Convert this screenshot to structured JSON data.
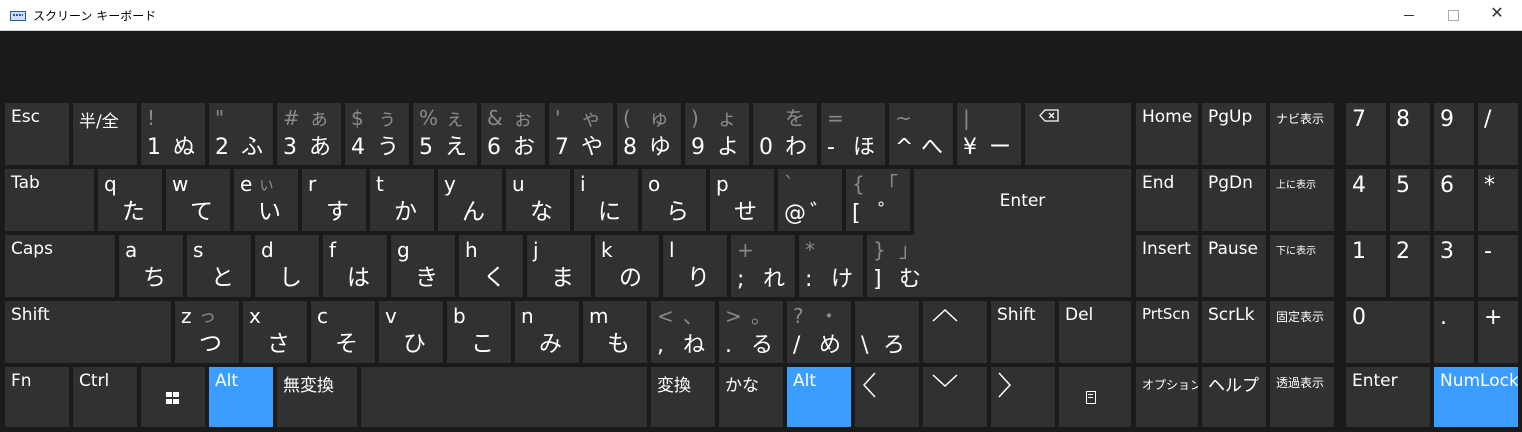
{
  "window": {
    "title": "スクリーン キーボード",
    "minimize": "—",
    "maximize": "□",
    "close": "✕"
  },
  "row1": [
    {
      "name": "esc",
      "label": "Esc"
    },
    {
      "name": "hankaku",
      "label": "半/全"
    },
    {
      "name": "1",
      "s": "!",
      "d": "1",
      "kt": "",
      "kb": "ぬ"
    },
    {
      "name": "2",
      "s": "\"",
      "d": "2",
      "kt": "",
      "kb": "ふ"
    },
    {
      "name": "3",
      "s": "#",
      "d": "3",
      "kt": "ぁ",
      "kb": "あ"
    },
    {
      "name": "4",
      "s": "$",
      "d": "4",
      "kt": "ぅ",
      "kb": "う"
    },
    {
      "name": "5",
      "s": "%",
      "d": "5",
      "kt": "ぇ",
      "kb": "え"
    },
    {
      "name": "6",
      "s": "&",
      "d": "6",
      "kt": "ぉ",
      "kb": "お"
    },
    {
      "name": "7",
      "s": "'",
      "d": "7",
      "kt": "ゃ",
      "kb": "や"
    },
    {
      "name": "8",
      "s": "(",
      "d": "8",
      "kt": "ゅ",
      "kb": "ゆ"
    },
    {
      "name": "9",
      "s": ")",
      "d": "9",
      "kt": "ょ",
      "kb": "よ"
    },
    {
      "name": "0",
      "s": "",
      "d": "0",
      "kt": "を",
      "kb": "わ"
    },
    {
      "name": "minus",
      "s": "=",
      "d": "-",
      "kt": "",
      "kb": "ほ"
    },
    {
      "name": "caret",
      "s": "~",
      "d": "^",
      "kt": "",
      "kb": "へ"
    },
    {
      "name": "yen",
      "s": "|",
      "d": "¥",
      "kt": "",
      "kb": "ー"
    }
  ],
  "row2": [
    {
      "name": "q",
      "l": "q",
      "k": "た"
    },
    {
      "name": "w",
      "l": "w",
      "k": "て"
    },
    {
      "name": "e",
      "l": "e",
      "kt": "ぃ",
      "k": "い"
    },
    {
      "name": "r",
      "l": "r",
      "k": "す"
    },
    {
      "name": "t",
      "l": "t",
      "k": "か"
    },
    {
      "name": "y",
      "l": "y",
      "k": "ん"
    },
    {
      "name": "u",
      "l": "u",
      "k": "な"
    },
    {
      "name": "i",
      "l": "i",
      "k": "に"
    },
    {
      "name": "o",
      "l": "o",
      "k": "ら"
    },
    {
      "name": "p",
      "l": "p",
      "k": "せ"
    }
  ],
  "row2_extra": {
    "at_s": "`",
    "at_d": "@",
    "at_k": "゛",
    "br_s": "{",
    "br_d": "[",
    "br_kt": "「",
    "br_k": "゜"
  },
  "row3": [
    {
      "name": "a",
      "l": "a",
      "k": "ち"
    },
    {
      "name": "s",
      "l": "s",
      "k": "と"
    },
    {
      "name": "d",
      "l": "d",
      "k": "し"
    },
    {
      "name": "f",
      "l": "f",
      "k": "は"
    },
    {
      "name": "g",
      "l": "g",
      "k": "き"
    },
    {
      "name": "h",
      "l": "h",
      "k": "く"
    },
    {
      "name": "j",
      "l": "j",
      "k": "ま"
    },
    {
      "name": "k",
      "l": "k",
      "k": "の"
    },
    {
      "name": "l",
      "l": "l",
      "k": "り"
    }
  ],
  "row3_extra": {
    "semi_s": "+",
    "semi_d": ";",
    "semi_k": "れ",
    "colon_s": "*",
    "colon_d": ":",
    "colon_k": "け",
    "rbr_s": "}",
    "rbr_d": "]",
    "rbr_kt": "」",
    "rbr_k": "む"
  },
  "row4": [
    {
      "name": "z",
      "l": "z",
      "kt": "っ",
      "k": "つ"
    },
    {
      "name": "x",
      "l": "x",
      "k": "さ"
    },
    {
      "name": "c",
      "l": "c",
      "k": "そ"
    },
    {
      "name": "v",
      "l": "v",
      "k": "ひ"
    },
    {
      "name": "b",
      "l": "b",
      "k": "こ"
    },
    {
      "name": "n",
      "l": "n",
      "k": "み"
    },
    {
      "name": "m",
      "l": "m",
      "k": "も"
    }
  ],
  "row4_extra": {
    "comma_s": "<",
    "comma_kt": "、",
    "comma_d": ",",
    "comma_k": "ね",
    "period_s": ">",
    "period_kt": "。",
    "period_d": ".",
    "period_k": "る",
    "slash_s": "?",
    "slash_kt": "・",
    "slash_d": "/",
    "slash_k": "め",
    "bs_d": "\\",
    "bs_k": "ろ"
  },
  "mods": {
    "tab": "Tab",
    "enter": "Enter",
    "caps": "Caps",
    "shift_l": "Shift",
    "shift_r": "Shift",
    "del": "Del",
    "fn": "Fn",
    "ctrl": "Ctrl",
    "alt_l": "Alt",
    "muhenkan": "無変換",
    "henkan": "変換",
    "kana": "かな",
    "alt_r": "Alt",
    "up": "^",
    "down": "v",
    "left": "<",
    "right": ">"
  },
  "nav": {
    "home": "Home",
    "pgup": "PgUp",
    "navi": "ナビ表示",
    "end": "End",
    "pgdn": "PgDn",
    "up_show": "上に表示",
    "insert": "Insert",
    "pause": "Pause",
    "down_show": "下に表示",
    "prtscn": "PrtScn",
    "scrlk": "ScrLk",
    "fix_show": "固定表示",
    "options": "オプション",
    "help": "ヘルプ",
    "trans_show": "透過表示"
  },
  "numpad": {
    "n7": "7",
    "n8": "8",
    "n9": "9",
    "div": "/",
    "n4": "4",
    "n5": "5",
    "n6": "6",
    "mul": "*",
    "n1": "1",
    "n2": "2",
    "n3": "3",
    "sub": "-",
    "n0": "0",
    "dot": ".",
    "add": "+",
    "enter": "Enter",
    "numlock": "NumLock"
  },
  "colors": {
    "key": "#313131",
    "highlight": "#3b9dff",
    "background": "#1a1a1a"
  }
}
